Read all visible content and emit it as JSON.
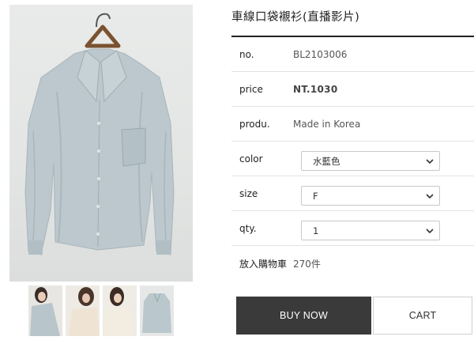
{
  "product": {
    "title": "車線口袋襯衫(直播影片)",
    "specs": {
      "no_label": "no.",
      "no_value": "BL2103006",
      "price_label": "price",
      "price_value": "NT.1030",
      "produ_label": "produ.",
      "produ_value": "Made in Korea",
      "color_label": "color",
      "color_value": "水藍色",
      "size_label": "size",
      "size_value": "F",
      "qty_label": "qty.",
      "qty_value": "1",
      "cart_count_label": "放入購物車",
      "cart_count_value": "270件"
    }
  },
  "buttons": {
    "buy_now": "BUY NOW",
    "cart": "CART"
  },
  "colors": {
    "shirt": "#b9c6cb",
    "buy_button": "#3a3a3a",
    "title_rule": "#222222"
  },
  "gallery": {
    "thumbnail_count": 4
  }
}
